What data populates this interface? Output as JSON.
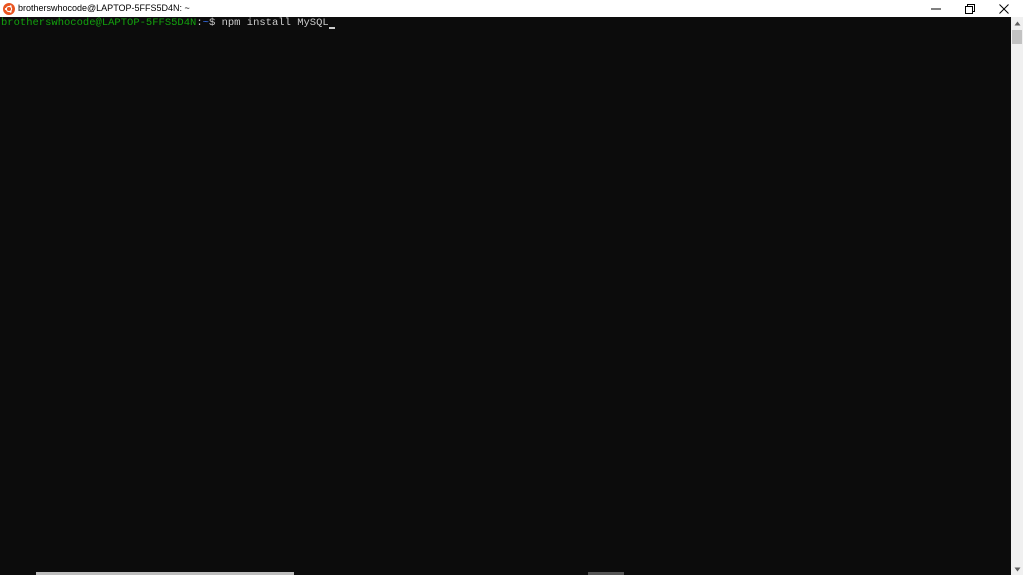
{
  "window": {
    "title": "brotherswhocode@LAPTOP-5FFS5D4N: ~",
    "app_icon": "ubuntu-icon",
    "controls": {
      "minimize": "minimize-icon",
      "maximize": "restore-icon",
      "close": "close-icon"
    }
  },
  "terminal": {
    "prompt": {
      "user_host": "brotherswhocode@LAPTOP-5FFS5D4N",
      "separator": ":",
      "path": "~",
      "symbol": "$ "
    },
    "command": "npm install MySQL"
  },
  "colors": {
    "background": "#0c0c0c",
    "user_host": "#13a10e",
    "path": "#3b78ff",
    "text": "#cccccc",
    "ubuntu_orange": "#e95420"
  }
}
